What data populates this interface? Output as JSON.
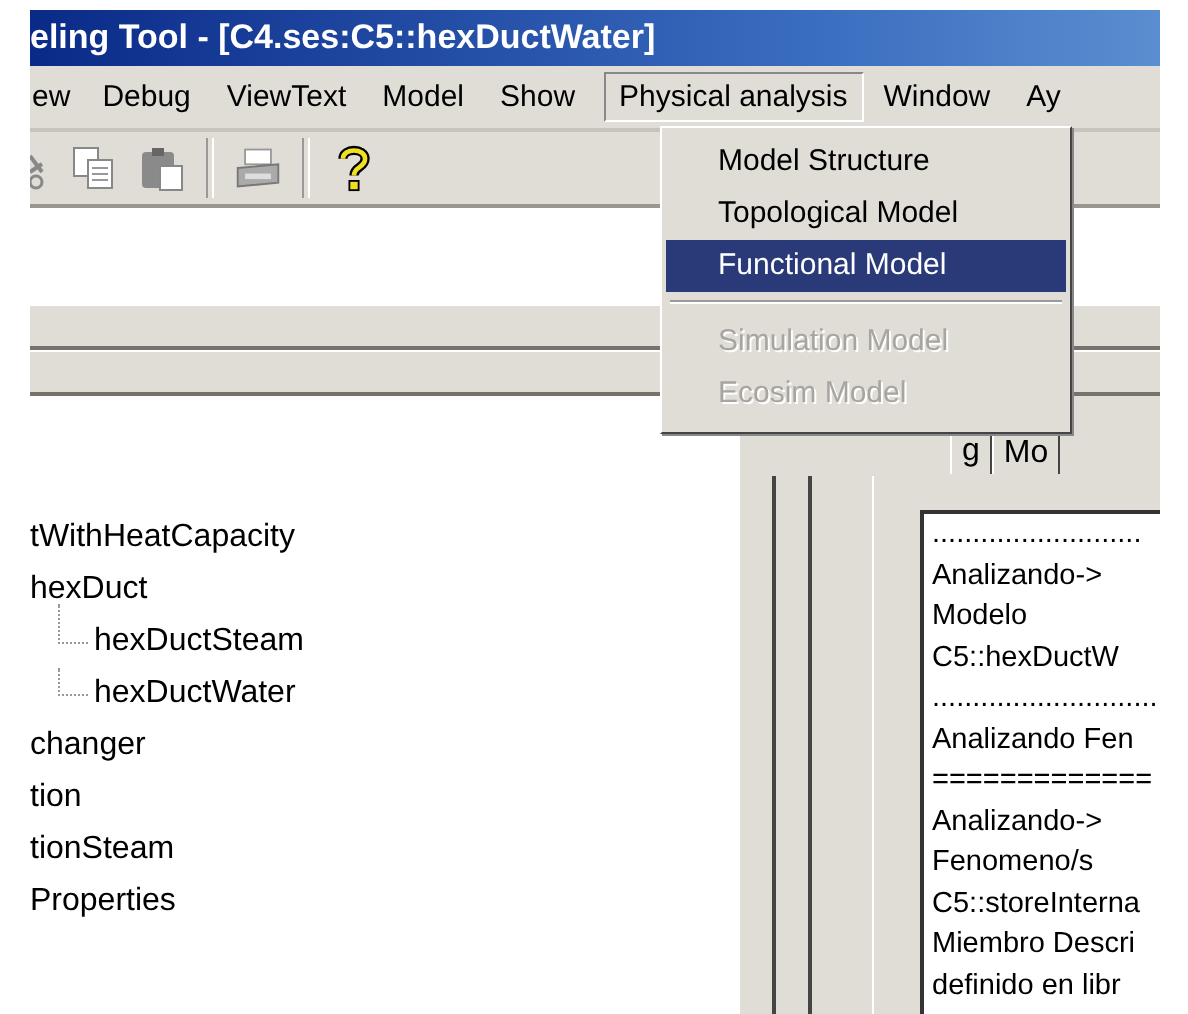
{
  "window": {
    "title": "eling Tool - [C4.ses:C5::hexDuctWater]"
  },
  "menu_bar": [
    {
      "label": "ew",
      "selected": false
    },
    {
      "label": "Debug",
      "selected": false
    },
    {
      "label": "ViewText",
      "selected": false
    },
    {
      "label": "Model",
      "selected": false
    },
    {
      "label": "Show",
      "selected": false
    },
    {
      "label": "Physical analysis",
      "selected": true
    },
    {
      "label": "Window",
      "selected": false
    },
    {
      "label": "Ay",
      "selected": false
    }
  ],
  "toolbar": [
    {
      "kind": "copy"
    },
    {
      "kind": "paste"
    },
    {
      "kind": "separator"
    },
    {
      "kind": "print"
    },
    {
      "kind": "separator"
    },
    {
      "kind": "help"
    }
  ],
  "dropdown_menu": [
    {
      "kind": "item",
      "label": "Model Structure",
      "selected": false,
      "disabled": false
    },
    {
      "kind": "item",
      "label": "Topological Model",
      "selected": false,
      "disabled": false
    },
    {
      "kind": "item",
      "label": "Functional Model",
      "selected": true,
      "disabled": false
    },
    {
      "kind": "separator"
    },
    {
      "kind": "item",
      "label": "Simulation Model",
      "selected": false,
      "disabled": true
    },
    {
      "kind": "item",
      "label": "Ecosim Model",
      "selected": false,
      "disabled": true
    }
  ],
  "tree": [
    {
      "label": "tWithHeatCapacity"
    },
    {
      "label": "hexDuct",
      "children": [
        {
          "label": "hexDuctSteam"
        },
        {
          "label": "hexDuctWater"
        }
      ]
    },
    {
      "label": "changer"
    },
    {
      "label": "tion"
    },
    {
      "label": "tionSteam"
    },
    {
      "label": "Properties"
    }
  ],
  "tabs": [
    {
      "label": "g",
      "selected": true
    },
    {
      "label": "Mo",
      "selected": false
    }
  ],
  "log": [
    "..........................",
    "Analizando->",
    "Modelo",
    "C5::hexDuctW",
    "............................",
    "Analizando Fen",
    "=============",
    "Analizando->",
    "Fenomeno/s",
    "C5::storeInterna",
    "Miembro Descri",
    "definido  en libr"
  ]
}
